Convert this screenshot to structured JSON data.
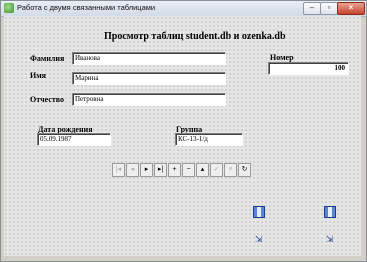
{
  "window": {
    "title": "Работа с двумя связанными таблицами",
    "minimize_glyph": "–",
    "maximize_glyph": "▫",
    "close_glyph": "×"
  },
  "form": {
    "heading": "Просмотр таблиц student.db и ozenka.db",
    "surname_label": "Фамилия",
    "surname_value": "Иванова",
    "name_label": "Имя",
    "name_value": "Марина",
    "patronymic_label": "Отчество",
    "patronymic_value": "Петровна",
    "number_label": "Номер",
    "number_value": "100",
    "birthdate_label": "Дата рождения",
    "birthdate_value": "05.09.1987",
    "group_label": "Группа",
    "group_value": "КС-13-1/д"
  },
  "navigator": {
    "buttons": [
      {
        "name": "first",
        "glyph": "|◂",
        "enabled": false
      },
      {
        "name": "prior",
        "glyph": "◂",
        "enabled": false
      },
      {
        "name": "next",
        "glyph": "▸",
        "enabled": true
      },
      {
        "name": "last",
        "glyph": "▸|",
        "enabled": true
      },
      {
        "name": "insert",
        "glyph": "+",
        "enabled": true
      },
      {
        "name": "delete",
        "glyph": "−",
        "enabled": true
      },
      {
        "name": "edit",
        "glyph": "▴",
        "enabled": true
      },
      {
        "name": "post",
        "glyph": "✓",
        "enabled": false
      },
      {
        "name": "cancel",
        "glyph": "×",
        "enabled": false
      },
      {
        "name": "refresh",
        "glyph": "↻",
        "enabled": true
      }
    ]
  },
  "icons": {
    "datasource": "table-icon",
    "table": "grid-icon"
  }
}
